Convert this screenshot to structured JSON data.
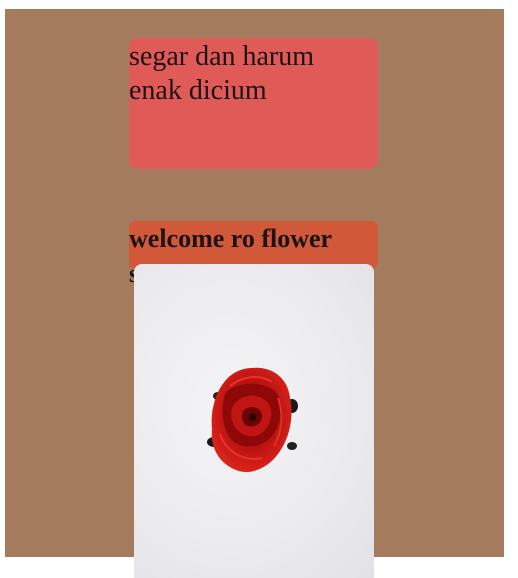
{
  "card": {
    "text": "segar dan harum\nenak dicium"
  },
  "banner": {
    "title": "welcome ro flower",
    "subtitle": "s"
  },
  "image": {
    "subject": "red-rose",
    "colors": {
      "background": "#a57b5e",
      "card": "#e05a57",
      "banner": "#d2583a",
      "photo_bg": "#ececef",
      "rose": "#c0100f"
    }
  }
}
